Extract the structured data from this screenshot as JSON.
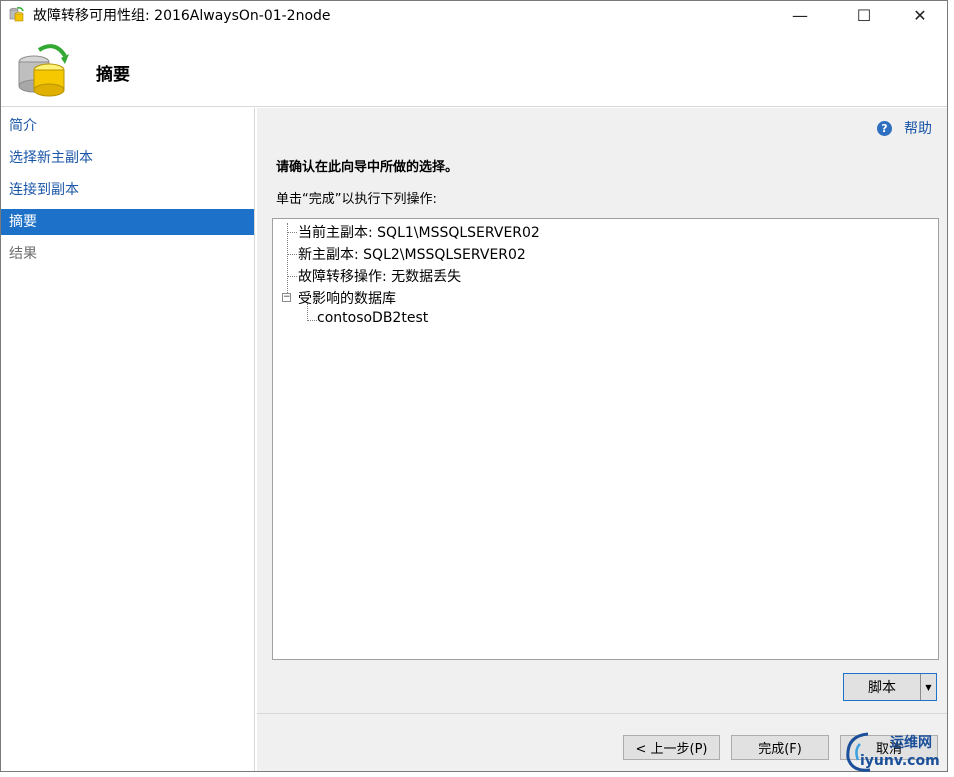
{
  "window": {
    "title": "故障转移可用性组: 2016AlwaysOn-01-2node",
    "minimize_glyph": "—",
    "maximize_glyph": "☐",
    "close_glyph": "✕"
  },
  "header": {
    "title": "摘要",
    "icon": "database-sync-icon"
  },
  "nav": {
    "items": [
      {
        "label": "简介",
        "state": "link"
      },
      {
        "label": "选择新主副本",
        "state": "link"
      },
      {
        "label": "连接到副本",
        "state": "link"
      },
      {
        "label": "摘要",
        "state": "selected"
      },
      {
        "label": "结果",
        "state": "disabled"
      }
    ]
  },
  "main": {
    "help_label": "帮助",
    "help_icon_glyph": "?",
    "instruction_bold": "请确认在此向导中所做的选择。",
    "instruction": "单击“完成”以执行下列操作:",
    "tree": {
      "items": [
        {
          "label": "当前主副本: SQL1\\MSSQLSERVER02"
        },
        {
          "label": "新主副本: SQL2\\MSSQLSERVER02"
        },
        {
          "label": "故障转移操作: 无数据丢失"
        },
        {
          "label": "受影响的数据库",
          "expander": "−"
        },
        {
          "label": "contosoDB2test"
        }
      ]
    },
    "script_label": "脚本",
    "script_drop_glyph": "▼"
  },
  "footer": {
    "back_label": "< 上一步(P)",
    "finish_label": "完成(F)",
    "cancel_label": "取消"
  },
  "watermark": {
    "line1": "运维网",
    "line2": "iyunv.com"
  },
  "colors": {
    "accent": "#1e71c8",
    "link": "#1a56a8",
    "panel": "#f0f0f0"
  }
}
